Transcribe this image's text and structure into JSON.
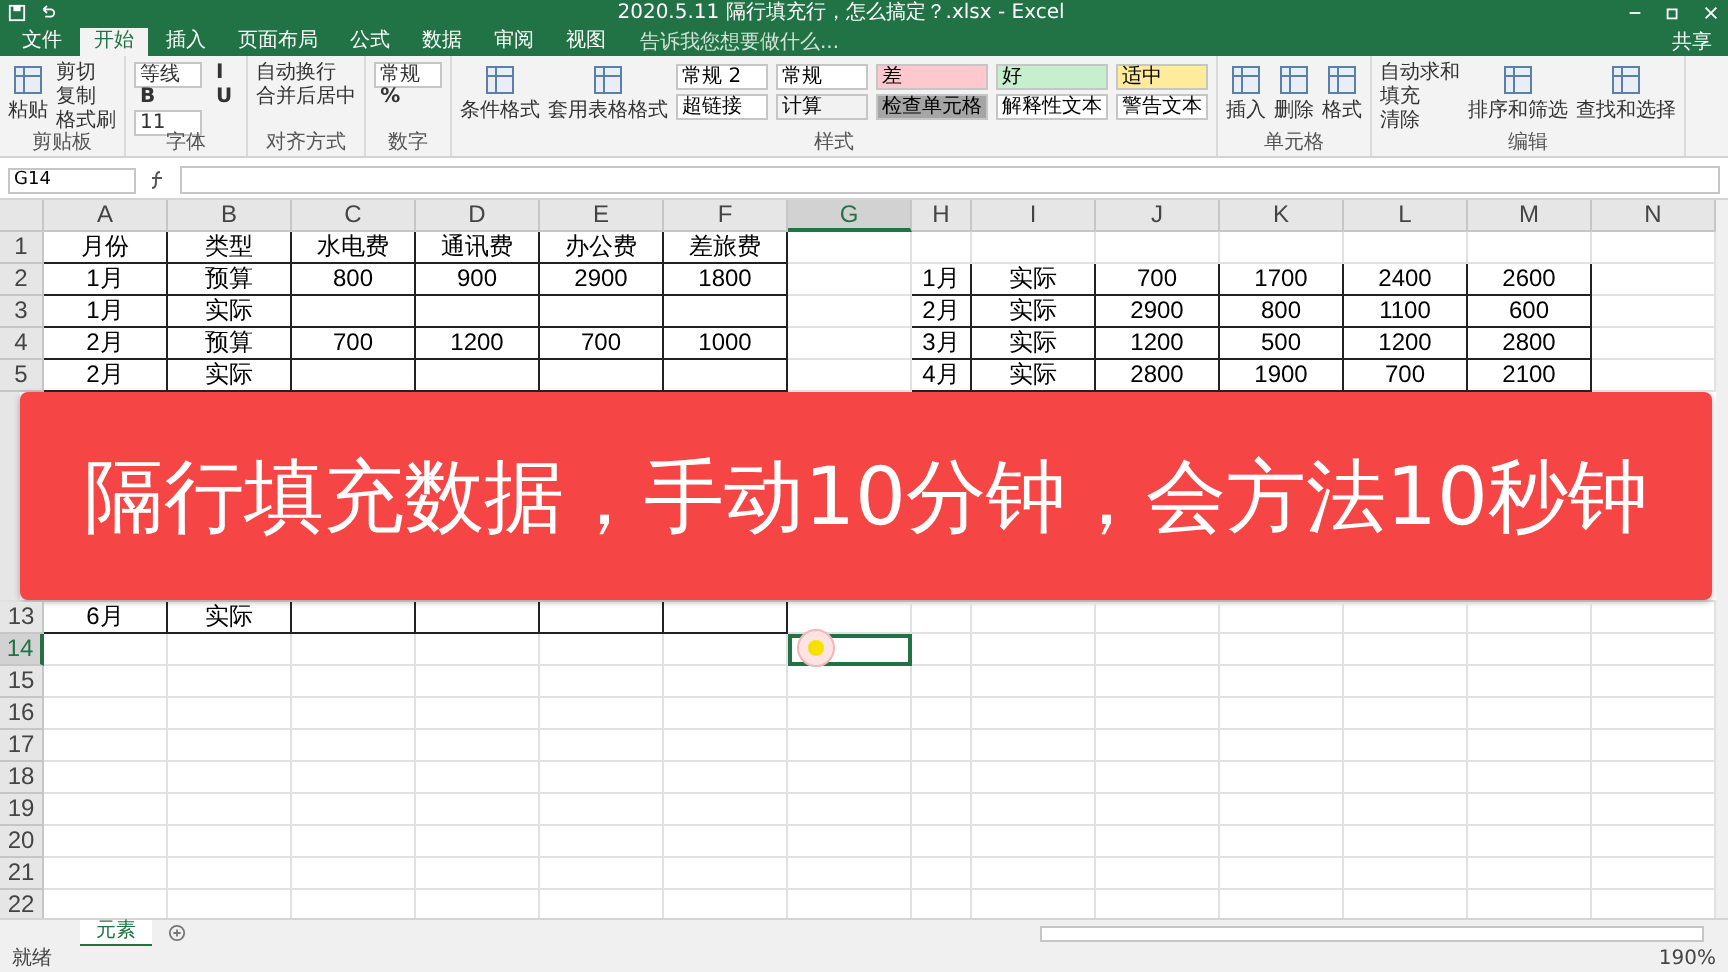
{
  "window": {
    "title": "2020.5.11 隔行填充行，怎么搞定？.xlsx - Excel"
  },
  "tabs": [
    {
      "label": "文件",
      "selected": false
    },
    {
      "label": "开始",
      "selected": true
    },
    {
      "label": "插入",
      "selected": false
    },
    {
      "label": "页面布局",
      "selected": false
    },
    {
      "label": "公式",
      "selected": false
    },
    {
      "label": "数据",
      "selected": false
    },
    {
      "label": "审阅",
      "selected": false
    },
    {
      "label": "视图",
      "selected": false
    }
  ],
  "tell_me": {
    "placeholder": "告诉我您想要做什么..."
  },
  "share": "共享",
  "ribbon": [
    {
      "label": "剪贴板",
      "items": [
        {
          "kind": "big",
          "label": "粘贴"
        },
        {
          "kind": "small",
          "label": "剪切"
        },
        {
          "kind": "small",
          "label": "复制"
        },
        {
          "kind": "small",
          "label": "格式刷"
        }
      ]
    },
    {
      "label": "字体",
      "items": [
        {
          "kind": "field",
          "label": "等线"
        },
        {
          "kind": "glyph",
          "label": "B"
        },
        {
          "kind": "field",
          "label": "11"
        },
        {
          "kind": "glyph",
          "label": "I"
        },
        {
          "kind": "glyph",
          "label": "U"
        }
      ]
    },
    {
      "label": "对齐方式",
      "items": [
        {
          "kind": "small",
          "label": "自动换行"
        },
        {
          "kind": "small",
          "label": "合并后居中"
        }
      ]
    },
    {
      "label": "数字",
      "items": [
        {
          "kind": "field",
          "label": "常规"
        },
        {
          "kind": "glyph",
          "label": "%"
        }
      ]
    },
    {
      "label": "样式",
      "items": [
        {
          "kind": "big",
          "label": "条件格式"
        },
        {
          "kind": "big",
          "label": "套用表格格式"
        }
      ],
      "swatches": [
        {
          "kind": "style",
          "label": "常规 2",
          "color": "#ffffff"
        },
        {
          "kind": "style",
          "label": "超链接",
          "color": "#ffffff"
        },
        {
          "kind": "style",
          "label": "常规",
          "color": "#ffffff"
        },
        {
          "kind": "style",
          "label": "计算",
          "color": "#f2f2f2"
        },
        {
          "kind": "style",
          "label": "差",
          "color": "#ffc7ce"
        },
        {
          "kind": "style",
          "label": "检查单元格",
          "color": "#a5a5a5"
        },
        {
          "kind": "style",
          "label": "好",
          "color": "#c6efce"
        },
        {
          "kind": "style",
          "label": "解释性文本",
          "color": "#ffffff"
        },
        {
          "kind": "style",
          "label": "适中",
          "color": "#ffeb9c"
        },
        {
          "kind": "style",
          "label": "警告文本",
          "color": "#ffffff"
        }
      ]
    },
    {
      "label": "单元格",
      "items": [
        {
          "kind": "big",
          "label": "插入"
        },
        {
          "kind": "big",
          "label": "删除"
        },
        {
          "kind": "big",
          "label": "格式"
        }
      ]
    },
    {
      "label": "编辑",
      "items": [
        {
          "kind": "small",
          "label": "自动求和"
        },
        {
          "kind": "small",
          "label": "填充"
        },
        {
          "kind": "small",
          "label": "清除"
        },
        {
          "kind": "big",
          "label": "排序和筛选"
        },
        {
          "kind": "big",
          "label": "查找和选择"
        }
      ]
    }
  ],
  "name_box": "G14",
  "columns": [
    {
      "label": "A",
      "selected": false
    },
    {
      "label": "B",
      "selected": false
    },
    {
      "label": "C",
      "selected": false
    },
    {
      "label": "D",
      "selected": false
    },
    {
      "label": "E",
      "selected": false
    },
    {
      "label": "F",
      "selected": false
    },
    {
      "label": "G",
      "selected": true
    },
    {
      "label": "H",
      "selected": false
    },
    {
      "label": "I",
      "selected": false
    },
    {
      "label": "J",
      "selected": false
    },
    {
      "label": "K",
      "selected": false
    },
    {
      "label": "L",
      "selected": false
    },
    {
      "label": "M",
      "selected": false
    },
    {
      "label": "N",
      "selected": false
    }
  ],
  "rows": [
    {
      "number": "1",
      "selected": false,
      "borders": {
        "A": true,
        "B": true,
        "C": true,
        "D": true,
        "E": true,
        "F": true
      },
      "cells": {
        "A": "月份",
        "B": "类型",
        "C": "水电费",
        "D": "通讯费",
        "E": "办公费",
        "F": "差旅费"
      }
    },
    {
      "number": "2",
      "selected": false,
      "borders": {
        "A": true,
        "B": true,
        "C": true,
        "D": true,
        "E": true,
        "F": true,
        "H": true,
        "I": true,
        "J": true,
        "K": true,
        "L": true,
        "M": true
      },
      "cells": {
        "A": "1月",
        "B": "预算",
        "C": "800",
        "D": "900",
        "E": "2900",
        "F": "1800",
        "H": "1月",
        "I": "实际",
        "J": "700",
        "K": "1700",
        "L": "2400",
        "M": "2600"
      }
    },
    {
      "number": "3",
      "selected": false,
      "borders": {
        "A": true,
        "B": true,
        "C": true,
        "D": true,
        "E": true,
        "F": true,
        "H": true,
        "I": true,
        "J": true,
        "K": true,
        "L": true,
        "M": true
      },
      "cells": {
        "A": "1月",
        "B": "实际",
        "H": "2月",
        "I": "实际",
        "J": "2900",
        "K": "800",
        "L": "1100",
        "M": "600"
      }
    },
    {
      "number": "4",
      "selected": false,
      "borders": {
        "A": true,
        "B": true,
        "C": true,
        "D": true,
        "E": true,
        "F": true,
        "H": true,
        "I": true,
        "J": true,
        "K": true,
        "L": true,
        "M": true
      },
      "cells": {
        "A": "2月",
        "B": "预算",
        "C": "700",
        "D": "1200",
        "E": "700",
        "F": "1000",
        "H": "3月",
        "I": "实际",
        "J": "1200",
        "K": "500",
        "L": "1200",
        "M": "2800"
      }
    },
    {
      "number": "5",
      "selected": false,
      "borders": {
        "A": true,
        "B": true,
        "C": true,
        "D": true,
        "E": true,
        "F": true,
        "H": true,
        "I": true,
        "J": true,
        "K": true,
        "L": true,
        "M": true
      },
      "cells": {
        "A": "2月",
        "B": "实际",
        "H": "4月",
        "I": "实际",
        "J": "2800",
        "K": "1900",
        "L": "700",
        "M": "2100"
      }
    },
    {
      "kind": "banner",
      "text": "隔行填充数据，手动10分钟，会方法10秒钟"
    },
    {
      "number": "13",
      "selected": false,
      "borders": {
        "A": true,
        "B": true,
        "C": true,
        "D": true,
        "E": true,
        "F": true
      },
      "cells": {
        "A": "6月",
        "B": "实际"
      }
    },
    {
      "number": "14",
      "selected": true,
      "selected_cells": {
        "G": true
      }
    },
    {
      "number": "15",
      "selected": false
    },
    {
      "number": "16",
      "selected": false
    },
    {
      "number": "17",
      "selected": false
    },
    {
      "number": "18",
      "selected": false
    },
    {
      "number": "19",
      "selected": false
    },
    {
      "number": "20",
      "selected": false
    },
    {
      "number": "21",
      "selected": false
    },
    {
      "number": "22",
      "selected": false
    }
  ],
  "sheets": [
    {
      "label": "元素",
      "selected": true
    }
  ],
  "status_bar": {
    "state": "就绪",
    "zoom": "190%"
  }
}
